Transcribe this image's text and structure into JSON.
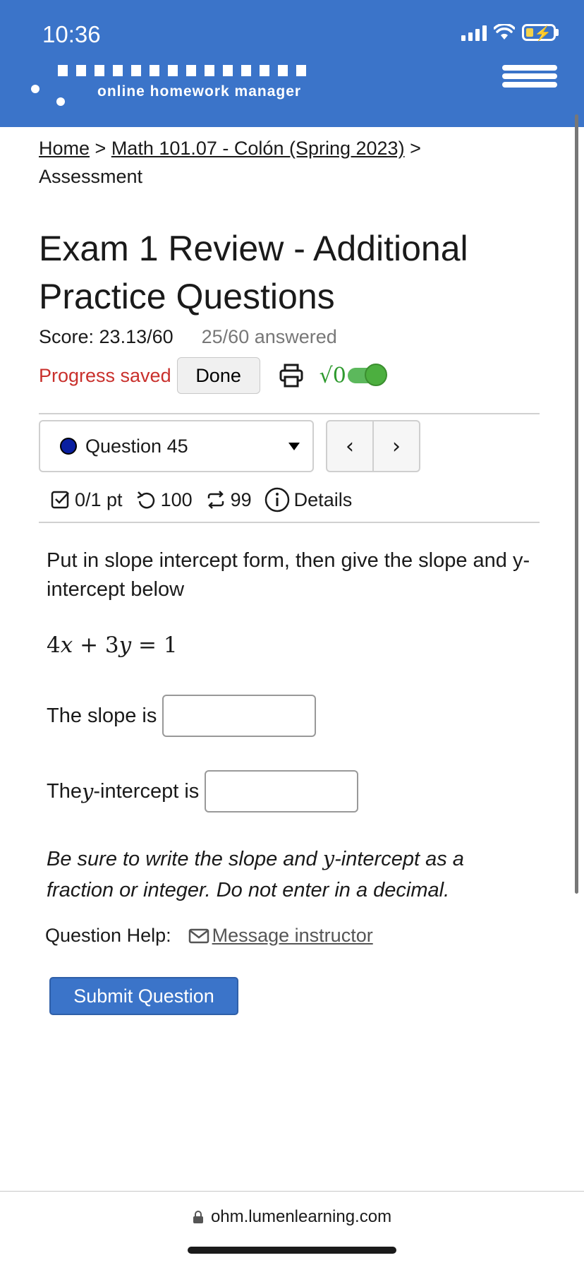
{
  "status_bar": {
    "time": "10:36"
  },
  "brand": {
    "tagline": "online homework manager"
  },
  "breadcrumb": {
    "home": "Home",
    "sep1": " > ",
    "course": "Math 101.07 - Colón (Spring 2023)",
    "sep2": " > ",
    "current": "Assessment"
  },
  "assessment": {
    "title": "Exam 1 Review - Additional Practice Questions",
    "score": "Score: 23.13/60",
    "answered": "25/60 answered",
    "progress_status": "Progress saved",
    "done_label": "Done",
    "math_toggle_label": "√0"
  },
  "question_nav": {
    "selected": "Question 45",
    "prev": "‹",
    "next": "›"
  },
  "question_meta": {
    "points": "0/1 pt",
    "retries": "100",
    "attempts": "99",
    "details": "Details"
  },
  "question": {
    "prompt": "Put in slope intercept form, then give the slope and y-intercept below",
    "equation": {
      "a": "4",
      "x": "x",
      "plus": " + ",
      "b": "3",
      "y": "y",
      "eq": " = ",
      "c": "1"
    },
    "slope_label": "The slope is",
    "yint_label_pre": "The ",
    "yint_var": "y",
    "yint_label_post": "-intercept is",
    "slope_value": "",
    "yint_value": "",
    "note_pre": "Be sure to write the slope and ",
    "note_var": "y",
    "note_post": "-intercept as a fraction or integer. Do not enter in a decimal."
  },
  "help": {
    "label": "Question Help:",
    "message_link": "Message instructor"
  },
  "submit_label": "Submit Question",
  "browser": {
    "url": "ohm.lumenlearning.com"
  },
  "colors": {
    "header": "#3b74c9",
    "progress": "#c9302c",
    "toggle": "#5cb85c"
  }
}
